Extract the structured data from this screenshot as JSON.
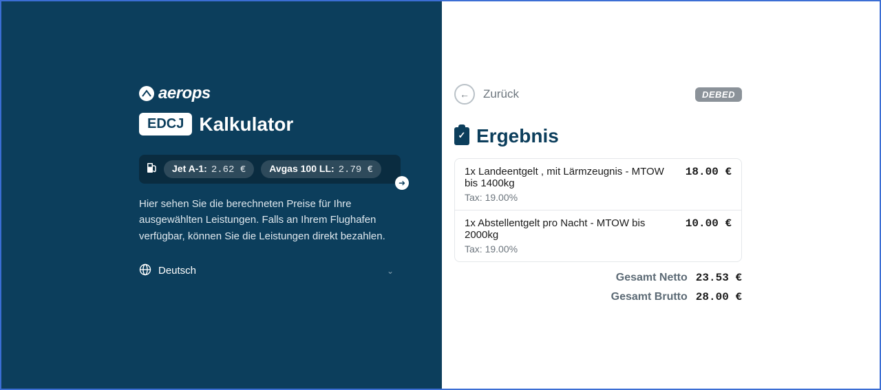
{
  "brand": {
    "name": "aerops"
  },
  "icao": "EDCJ",
  "title": "Kalkulator",
  "fuel": {
    "jet_a1_label": "Jet A-1:",
    "jet_a1_price": "2.62 €",
    "avgas_label": "Avgas 100 LL:",
    "avgas_price": "2.79 €"
  },
  "description": "Hier sehen Sie die berechneten Preise für Ihre ausgewählten Leistungen. Falls an Ihrem Flughafen verfügbar, können Sie die Leistungen direkt bezahlen.",
  "language": "Deutsch",
  "back_label": "Zurück",
  "registration": "DEBED",
  "result_heading": "Ergebnis",
  "items": [
    {
      "desc": "1x Landeentgelt , mit Lärmzeugnis - MTOW bis 1400kg",
      "price": "18.00 €",
      "tax": "Tax: 19.00%"
    },
    {
      "desc": "1x Abstellentgelt pro Nacht - MTOW bis 2000kg",
      "price": "10.00 €",
      "tax": "Tax: 19.00%"
    }
  ],
  "totals": {
    "net_label": "Gesamt Netto",
    "net_value": "23.53 €",
    "gross_label": "Gesamt Brutto",
    "gross_value": "28.00 €"
  }
}
